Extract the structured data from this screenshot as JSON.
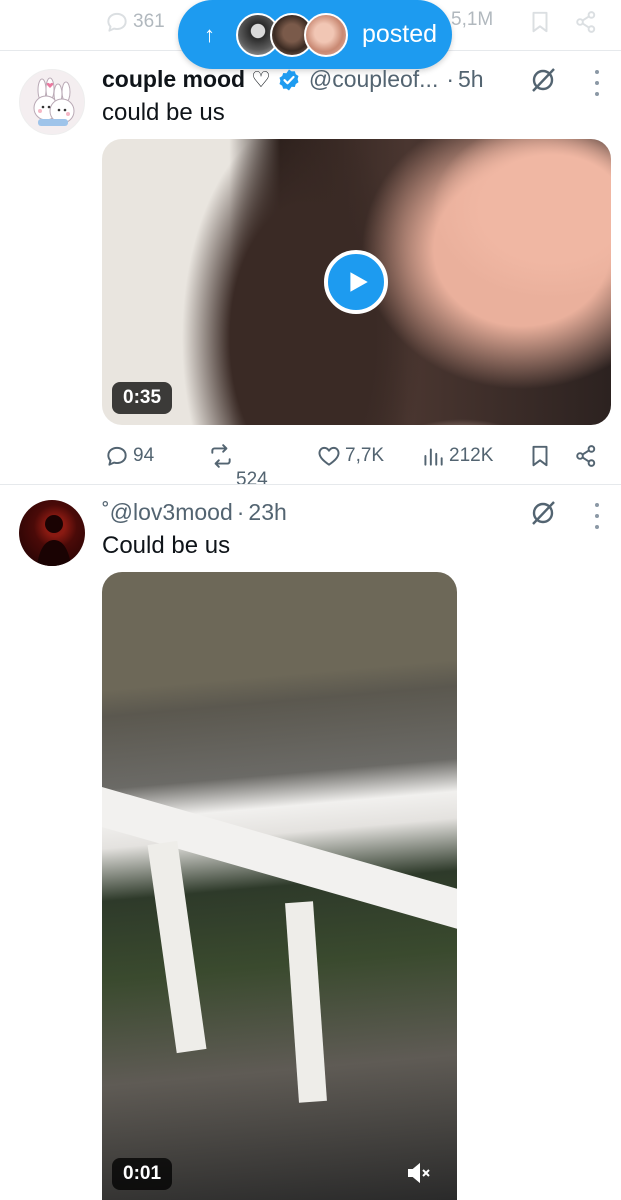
{
  "top_actions": {
    "replies": "361",
    "views": "5,1M",
    "icons": [
      "reply-icon",
      "bookmark-icon",
      "share-icon"
    ]
  },
  "new_posts_pill": {
    "arrow": "↑",
    "label": "posted"
  },
  "tweets": [
    {
      "display_name": "couple mood",
      "name_suffix": "♡",
      "verified": true,
      "handle": "@coupleof...",
      "separator": "·",
      "time": "5h",
      "text": "could be us",
      "media": {
        "type": "video",
        "duration": "0:35",
        "has_play_button": true
      },
      "actions": {
        "replies": "94",
        "reposts": "524",
        "likes": "7,7K",
        "views": "212K"
      }
    },
    {
      "handle_prefix": "˚",
      "handle": "@lov3mood",
      "separator": "·",
      "time": "23h",
      "text": "Could be us",
      "media": {
        "type": "video",
        "duration": "0:01",
        "muted": true
      }
    }
  ],
  "colors": {
    "accent": "#1d9bf0",
    "text": "#0f1419",
    "secondary": "#536471",
    "divider": "#e6e9ec"
  }
}
